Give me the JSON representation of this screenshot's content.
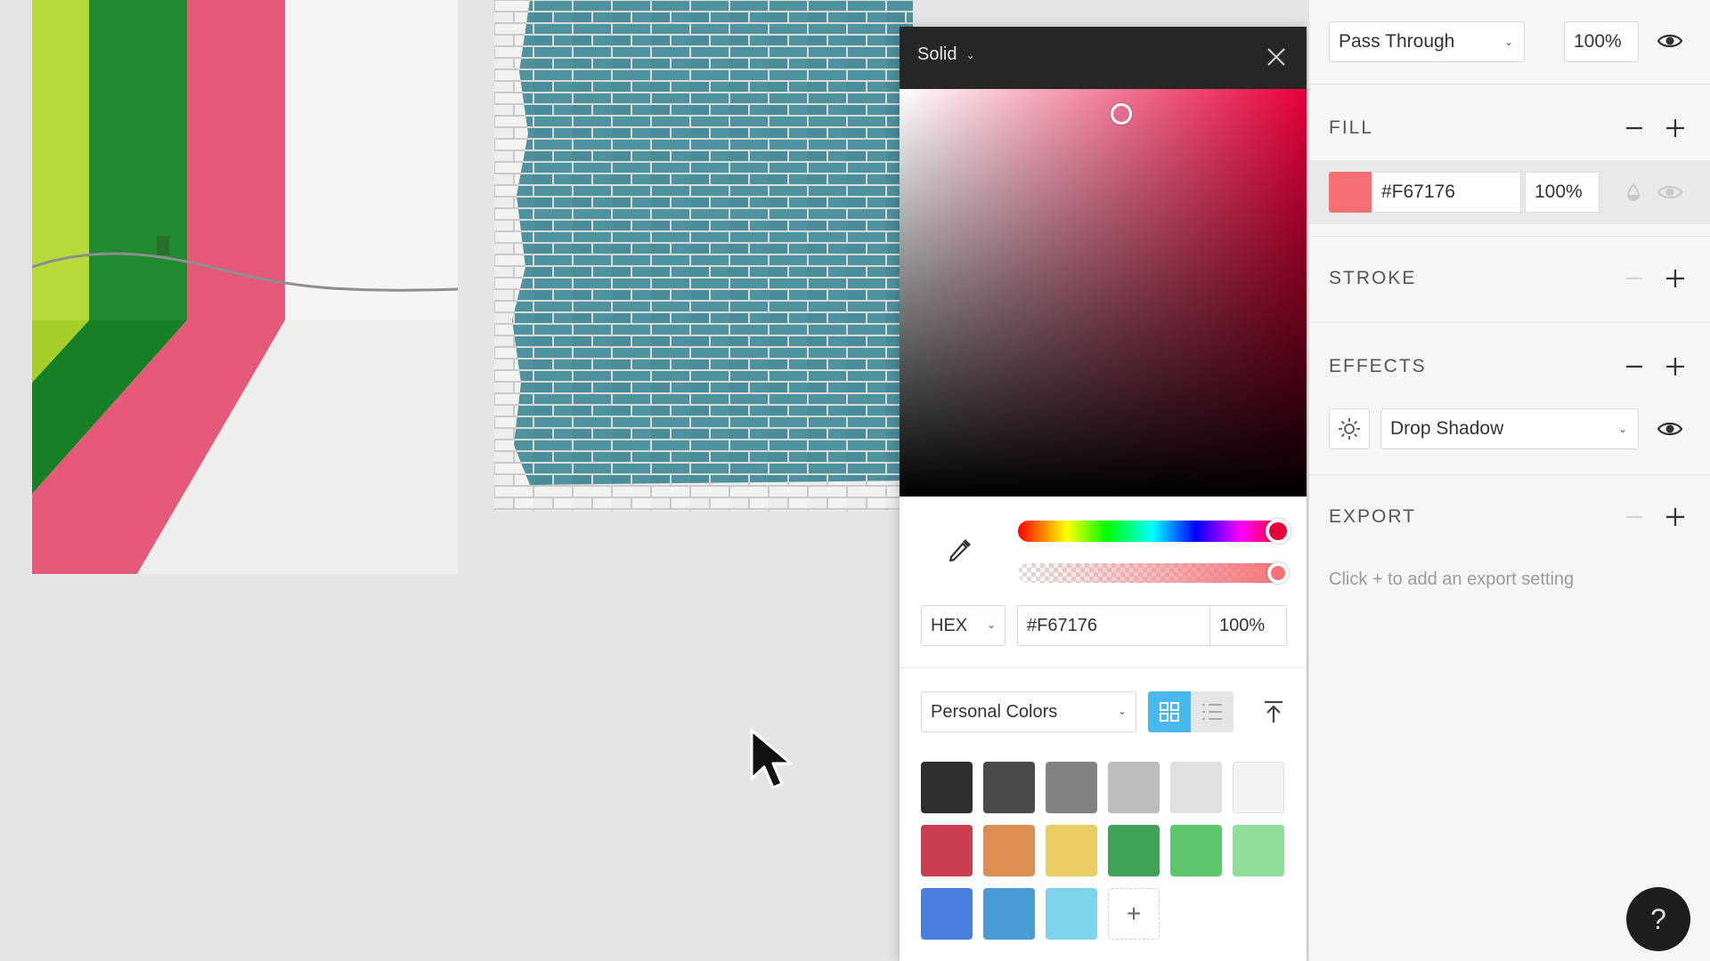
{
  "picker": {
    "fill_type": "Solid",
    "color_mode": "HEX",
    "hex_value": "#F67176",
    "alpha_value": "100%",
    "palette_name": "Personal Colors",
    "swatches": [
      "#2f2f2f",
      "#4a4a4a",
      "#838383",
      "#bdbdbd",
      "#e0e0e0",
      "#f3f3f3",
      "#c8404f",
      "#dd8e52",
      "#e8cd62",
      "#41a256",
      "#5dc76d",
      "#8fdf98",
      "#4a7fde",
      "#4a9bd3",
      "#7ed2ea"
    ],
    "add_swatch_label": "+",
    "selected_color": "#F67176",
    "hue_color": "#e8003a",
    "accent_color": "#49b8ef"
  },
  "inspector": {
    "blend_mode": "Pass Through",
    "layer_opacity": "100%",
    "fill": {
      "title": "FILL",
      "hex": "#F67176",
      "opacity": "100%"
    },
    "stroke": {
      "title": "STROKE"
    },
    "effects": {
      "title": "EFFECTS",
      "effect_type": "Drop Shadow"
    },
    "export": {
      "title": "EXPORT",
      "hint": "Click + to add an export setting"
    }
  },
  "help_label": "?"
}
